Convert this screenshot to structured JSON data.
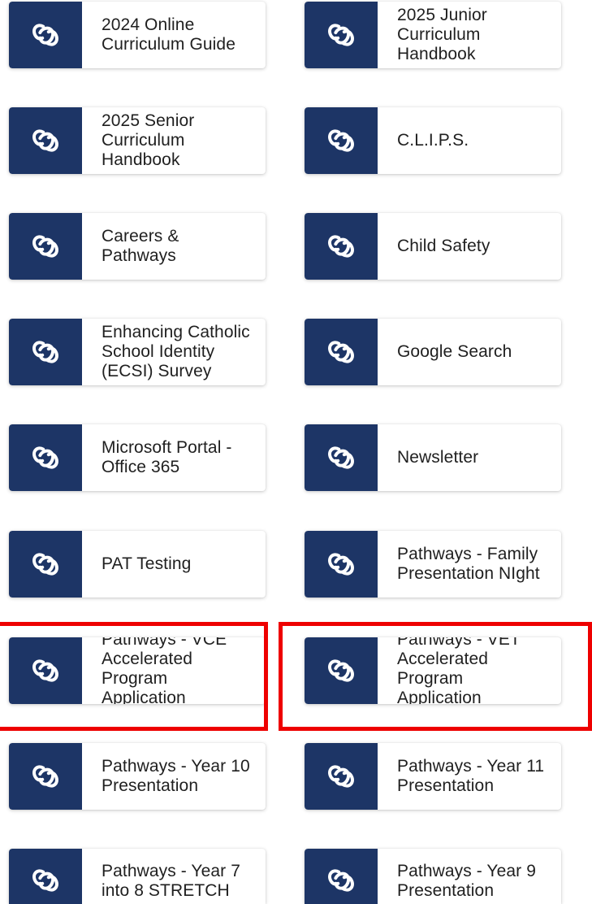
{
  "tiles": [
    {
      "label": "2024 Online\nCurriculum Guide",
      "icon": "link-icon"
    },
    {
      "label": "2025 Junior\nCurriculum\nHandbook",
      "icon": "link-icon"
    },
    {
      "label": "2025 Senior\nCurriculum\nHandbook",
      "icon": "link-icon"
    },
    {
      "label": "C.L.I.P.S.",
      "icon": "link-icon"
    },
    {
      "label": "Careers &\nPathways",
      "icon": "link-icon"
    },
    {
      "label": "Child Safety",
      "icon": "link-icon"
    },
    {
      "label": "Enhancing Catholic\nSchool Identity\n(ECSI) Survey",
      "icon": "link-icon"
    },
    {
      "label": "Google Search",
      "icon": "link-icon"
    },
    {
      "label": "Microsoft Portal -\nOffice 365",
      "icon": "link-icon"
    },
    {
      "label": "Newsletter",
      "icon": "link-icon"
    },
    {
      "label": "PAT Testing",
      "icon": "link-icon"
    },
    {
      "label": "Pathways - Family\nPresentation NIght",
      "icon": "link-icon"
    },
    {
      "label": "Pathways - VCE\nAccelerated\nProgram\nApplication",
      "icon": "link-icon"
    },
    {
      "label": "Pathways - VET\nAccelerated\nProgram\nApplication",
      "icon": "link-icon"
    },
    {
      "label": "Pathways - Year 10\nPresentation",
      "icon": "link-icon"
    },
    {
      "label": "Pathways - Year 11\nPresentation",
      "icon": "link-icon"
    },
    {
      "label": "Pathways - Year 7\ninto 8 STRETCH",
      "icon": "link-icon"
    },
    {
      "label": "Pathways - Year 9\nPresentation",
      "icon": "link-icon"
    }
  ],
  "colors": {
    "icon_background": "#1d3566",
    "highlight": "#ee0000"
  }
}
